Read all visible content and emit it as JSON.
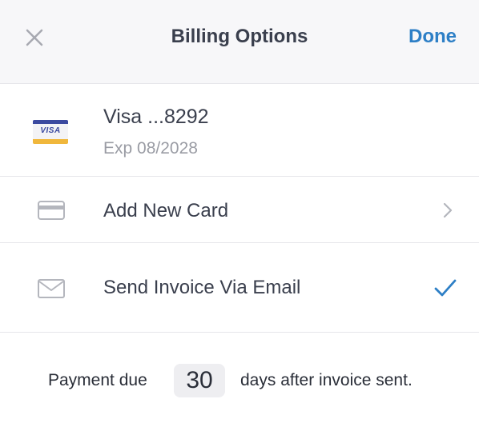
{
  "header": {
    "title": "Billing Options",
    "done_label": "Done",
    "close_icon": "close-icon"
  },
  "saved_card": {
    "brand_logo": "VISA",
    "name": "Visa ...8292",
    "expiry": "Exp 08/2028"
  },
  "add_card": {
    "label": "Add New Card",
    "icon": "credit-card-icon"
  },
  "email_invoice": {
    "label": "Send Invoice Via Email",
    "icon": "envelope-icon",
    "selected": true
  },
  "payment": {
    "prefix": "Payment due",
    "days": "30",
    "suffix": "days after invoice sent."
  },
  "colors": {
    "accent": "#2d7fc6",
    "header_bg": "#f7f7f9",
    "text": "#3a3f4d",
    "muted": "#9a9ca4"
  }
}
